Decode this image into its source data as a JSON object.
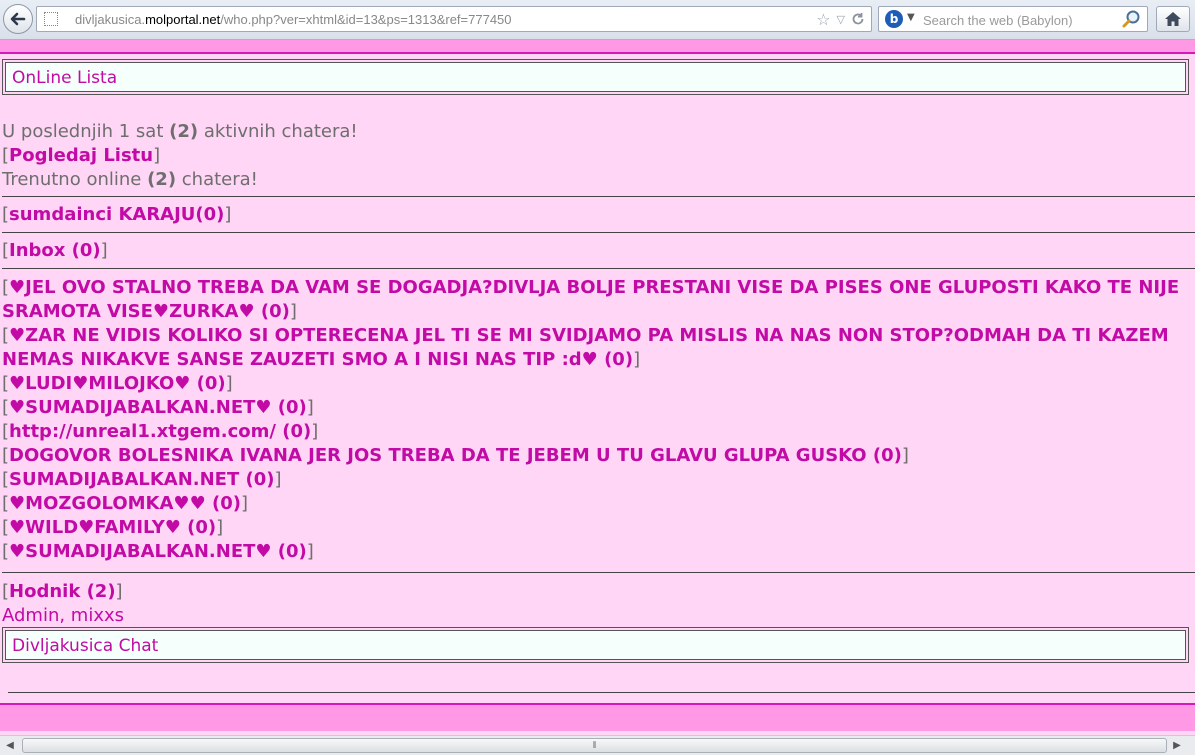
{
  "browser": {
    "url_prefix": "divljakusica.",
    "url_domain": "molportal.net",
    "url_path": "/who.php?ver=xhtml&id=13&ps=1313&ref=777450",
    "search_placeholder": "Search the web (Babylon)",
    "search_engine_icon": "b"
  },
  "page": {
    "header_title": "OnLine Lista",
    "active_prefix": "U poslednjih 1 sat ",
    "active_count": "(2)",
    "active_suffix": " aktivnih chatera!",
    "view_list_label": "Pogledaj Listu",
    "online_prefix": "Trenutno online ",
    "online_count": "(2)",
    "online_suffix": " chatera!",
    "group_link": "sumdainci KARAJU(0)",
    "inbox_link": "Inbox (0)",
    "rooms": [
      "♥JEL OVO STALNO TREBA DA VAM SE DOGADJA?DIVLJA BOLJE PRESTANI VISE DA PISES ONE GLUPOSTI KAKO TE NIJE SRAMOTA VISE♥ZURKA♥ (0)",
      "♥ZAR NE VIDIS KOLIKO SI OPTERECENA JEL TI SE MI SVIDJAMO PA MISLIS NA NAS NON STOP?ODMAH DA TI KAZEM NEMAS NIKAKVE SANSE ZAUZETI SMO A I NISI NAS TIP :d♥ (0)",
      "♥LUDI♥MILOJKO♥ (0)",
      "♥SUMADIJABALKAN.NET♥ (0)",
      "http://unreal1.xtgem.com/ (0)",
      "DOGOVOR BOLESNIKA IVANA JER JOS TREBA DA TE JEBEM U TU GLAVU GLUPA GUSKO (0)",
      "SUMADIJABALKAN.NET (0)",
      "♥MOZGOLOMKA♥♥ (0)",
      "♥WILD♥FAMILY♥ (0)",
      "♥SUMADIJABALKAN.NET♥ (0)"
    ],
    "hallway_link": "Hodnik (2)",
    "hallway_users": "Admin, mixxs",
    "footer_title": "Divljakusica Chat"
  },
  "colors": {
    "page_bg": "#ffd6f5",
    "band": "#ff99e5",
    "link": "#c20aa6"
  },
  "icons": {
    "back": "back-arrow-icon",
    "star": "star-icon",
    "reload": "reload-icon",
    "search": "magnifier-icon",
    "home": "home-icon"
  }
}
